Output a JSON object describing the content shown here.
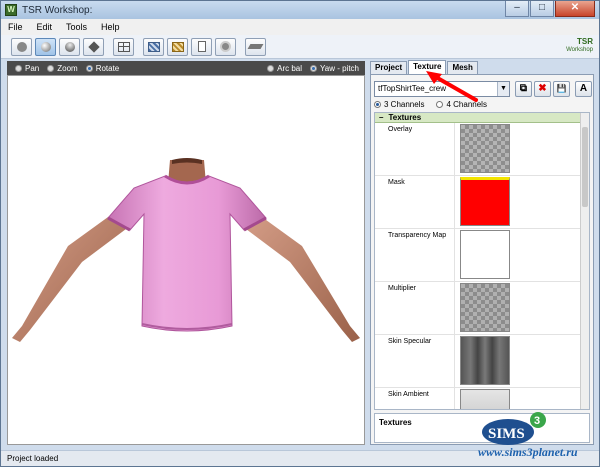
{
  "window": {
    "title": "TSR Workshop:",
    "controls": {
      "minimize": "–",
      "maximize": "□",
      "close": "✕"
    }
  },
  "menu": [
    "File",
    "Edit",
    "Tools",
    "Help"
  ],
  "toolbar": {
    "buttons": [
      {
        "icon": "sphere-flat-icon"
      },
      {
        "icon": "sphere-shaded-icon",
        "active": true
      },
      {
        "icon": "sphere-smooth-icon"
      },
      {
        "icon": "box-icon"
      },
      {
        "icon": "grid-icon"
      },
      {
        "icon": "mesh-blue-icon"
      },
      {
        "icon": "mesh-gold-icon"
      },
      {
        "icon": "page-icon"
      },
      {
        "icon": "disc-icon"
      },
      {
        "icon": "plane-icon"
      }
    ],
    "logo_top": "TSR",
    "logo_bottom": "Workshop"
  },
  "viewport_controls": {
    "left": [
      {
        "label": "Pan",
        "checked": false
      },
      {
        "label": "Zoom",
        "checked": false
      },
      {
        "label": "Rotate",
        "checked": true
      }
    ],
    "right": [
      {
        "label": "Arc bal",
        "checked": false
      },
      {
        "label": "Yaw - pitch",
        "checked": true
      }
    ]
  },
  "tabs": [
    "Project",
    "Texture",
    "Mesh"
  ],
  "active_tab": "Texture",
  "texture_panel": {
    "selected_texture": "tfTopShirtTee_crew",
    "buttons": {
      "copy": "⧉",
      "delete": "✖",
      "save": "💾",
      "text": "A"
    },
    "channels": [
      {
        "label": "3 Channels",
        "checked": true
      },
      {
        "label": "4 Channels",
        "checked": false
      }
    ],
    "group_label": "Textures",
    "group_toggle": "–",
    "rows": [
      {
        "label": "Overlay",
        "swatch": "checker"
      },
      {
        "label": "Mask",
        "swatch": "red"
      },
      {
        "label": "Transparency Map",
        "swatch": "white"
      },
      {
        "label": "Multiplier",
        "swatch": "grayish"
      },
      {
        "label": "Skin Specular",
        "swatch": "specular"
      },
      {
        "label": "Skin Ambient",
        "swatch": "ambient"
      }
    ],
    "description_title": "Textures"
  },
  "status": "Project loaded",
  "watermark": "www.sims3planet.ru",
  "sims_logo": "SIMS 3",
  "colors": {
    "shirt": "#e59ad4",
    "skin": "#c08669",
    "mask": "#ff0000",
    "arrow": "#ff0000"
  }
}
